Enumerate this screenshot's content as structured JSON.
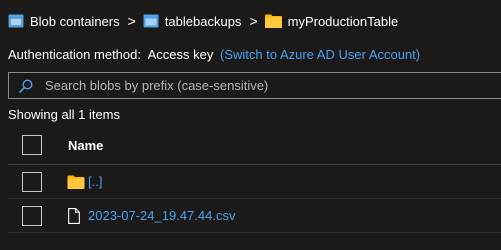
{
  "breadcrumb": {
    "items": [
      {
        "label": "Blob containers",
        "icon": "blob-container-icon"
      },
      {
        "label": "tablebackups",
        "icon": "blob-container-icon"
      },
      {
        "label": "myProductionTable",
        "icon": "folder-icon"
      }
    ],
    "separator": ">"
  },
  "auth": {
    "label": "Authentication method:",
    "value": "Access key",
    "link": "(Switch to Azure AD User Account)"
  },
  "search": {
    "placeholder": "Search blobs by prefix (case-sensitive)",
    "value": "",
    "icon": "search-icon"
  },
  "status": "Showing all 1 items",
  "table": {
    "header": {
      "name": "Name"
    },
    "rows": [
      {
        "name": "[..]",
        "icon": "folder-icon"
      },
      {
        "name": "2023-07-24_19.47.44.csv",
        "icon": "file-icon"
      }
    ]
  },
  "colors": {
    "background": "#1b1a19",
    "link": "#4aa0f0",
    "folder": "#ffb900",
    "container_icon": "#50a0e6",
    "border": "#8a8886"
  }
}
